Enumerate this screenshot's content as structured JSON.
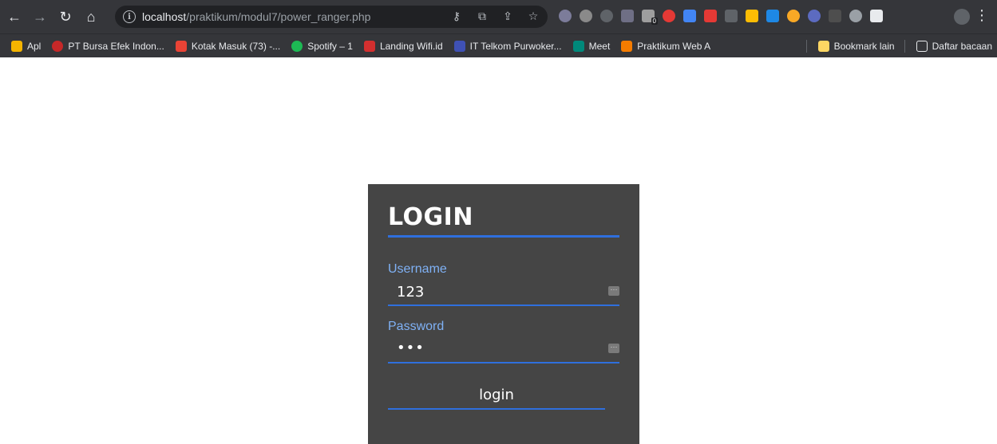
{
  "browser": {
    "url_host": "localhost",
    "url_path": "/praktikum/modul7/power_ranger.php",
    "extension_badge": "0"
  },
  "bookmarks": {
    "items": [
      {
        "label": "Apl",
        "color": "#f4b400"
      },
      {
        "label": "PT Bursa Efek Indon...",
        "color": "#c62828"
      },
      {
        "label": "Kotak Masuk (73) -...",
        "color": "#ea4335"
      },
      {
        "label": "Spotify – 1",
        "color": "#1db954"
      },
      {
        "label": "Landing Wifi.id",
        "color": "#d32f2f"
      },
      {
        "label": "IT Telkom Purwoker...",
        "color": "#3f51b5"
      },
      {
        "label": "Meet",
        "color": "#00897b"
      },
      {
        "label": "Praktikum Web A",
        "color": "#f57c00"
      }
    ],
    "other": "Bookmark lain",
    "reading_list": "Daftar bacaan"
  },
  "login": {
    "title": "LOGIN",
    "username_label": "Username",
    "username_value": "123",
    "password_label": "Password",
    "password_display": "•••",
    "button_label": "login",
    "accent": "#2f6fdd",
    "label_color": "#7fb1f5",
    "card_bg": "#454545"
  }
}
